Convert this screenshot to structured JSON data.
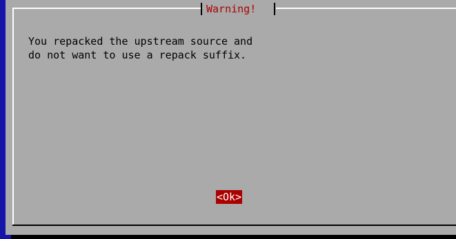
{
  "dialog": {
    "title": "Warning!",
    "message_lines": [
      "You repacked the upstream source and",
      "do not want to use a repack suffix."
    ],
    "ok_button_label": "<Ok>"
  },
  "colors": {
    "background": "#1414a8",
    "dialog_bg": "#aaaaaa",
    "title_text": "#aa0000",
    "button_bg": "#aa0000",
    "button_text": "#ffffff",
    "frame_light": "#ffffff",
    "frame_dark": "#000000"
  }
}
